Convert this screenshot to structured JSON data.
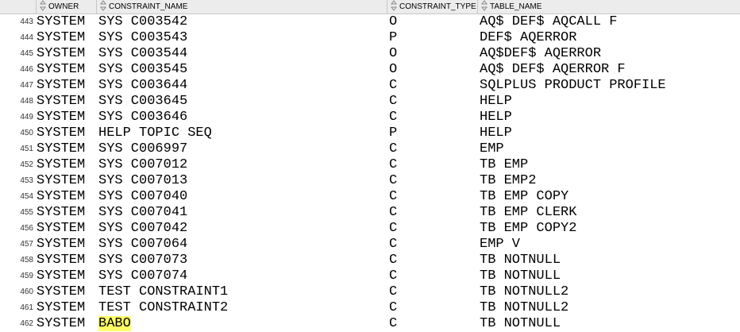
{
  "columns": {
    "owner": "OWNER",
    "constraint_name": "CONSTRAINT_NAME",
    "constraint_type": "CONSTRAINT_TYPE",
    "table_name": "TABLE_NAME"
  },
  "rows": [
    {
      "n": "443",
      "owner": "SYSTEM",
      "cname": "SYS C003542",
      "ctype": "O",
      "tname": "AQ$ DEF$ AQCALL F"
    },
    {
      "n": "444",
      "owner": "SYSTEM",
      "cname": "SYS C003543",
      "ctype": "P",
      "tname": "DEF$ AQERROR"
    },
    {
      "n": "445",
      "owner": "SYSTEM",
      "cname": "SYS C003544",
      "ctype": "O",
      "tname": "AQ$DEF$ AQERROR"
    },
    {
      "n": "446",
      "owner": "SYSTEM",
      "cname": "SYS C003545",
      "ctype": "O",
      "tname": "AQ$ DEF$ AQERROR F"
    },
    {
      "n": "447",
      "owner": "SYSTEM",
      "cname": "SYS C003644",
      "ctype": "C",
      "tname": "SQLPLUS PRODUCT PROFILE"
    },
    {
      "n": "448",
      "owner": "SYSTEM",
      "cname": "SYS C003645",
      "ctype": "C",
      "tname": "HELP"
    },
    {
      "n": "449",
      "owner": "SYSTEM",
      "cname": "SYS C003646",
      "ctype": "C",
      "tname": "HELP"
    },
    {
      "n": "450",
      "owner": "SYSTEM",
      "cname": "HELP TOPIC SEQ",
      "ctype": "P",
      "tname": "HELP"
    },
    {
      "n": "451",
      "owner": "SYSTEM",
      "cname": "SYS C006997",
      "ctype": "C",
      "tname": "EMP"
    },
    {
      "n": "452",
      "owner": "SYSTEM",
      "cname": "SYS C007012",
      "ctype": "C",
      "tname": "TB EMP"
    },
    {
      "n": "453",
      "owner": "SYSTEM",
      "cname": "SYS C007013",
      "ctype": "C",
      "tname": "TB EMP2"
    },
    {
      "n": "454",
      "owner": "SYSTEM",
      "cname": "SYS C007040",
      "ctype": "C",
      "tname": "TB EMP COPY"
    },
    {
      "n": "455",
      "owner": "SYSTEM",
      "cname": "SYS C007041",
      "ctype": "C",
      "tname": "TB EMP CLERK"
    },
    {
      "n": "456",
      "owner": "SYSTEM",
      "cname": "SYS C007042",
      "ctype": "C",
      "tname": "TB EMP COPY2"
    },
    {
      "n": "457",
      "owner": "SYSTEM",
      "cname": "SYS C007064",
      "ctype": "C",
      "tname": "EMP V"
    },
    {
      "n": "458",
      "owner": "SYSTEM",
      "cname": "SYS C007073",
      "ctype": "C",
      "tname": "TB NOTNULL"
    },
    {
      "n": "459",
      "owner": "SYSTEM",
      "cname": "SYS C007074",
      "ctype": "C",
      "tname": "TB NOTNULL"
    },
    {
      "n": "460",
      "owner": "SYSTEM",
      "cname": "TEST CONSTRAINT1",
      "ctype": "C",
      "tname": "TB NOTNULL2"
    },
    {
      "n": "461",
      "owner": "SYSTEM",
      "cname": "TEST CONSTRAINT2",
      "ctype": "C",
      "tname": "TB NOTNULL2"
    },
    {
      "n": "462",
      "owner": "SYSTEM",
      "cname": "BABO",
      "ctype": "C",
      "tname": "TB NOTNULL",
      "highlight": true
    }
  ],
  "colors": {
    "header_bg": "#ececec",
    "highlight": "#ffff66"
  },
  "icons": {
    "sort": "sort-arrows-icon"
  }
}
